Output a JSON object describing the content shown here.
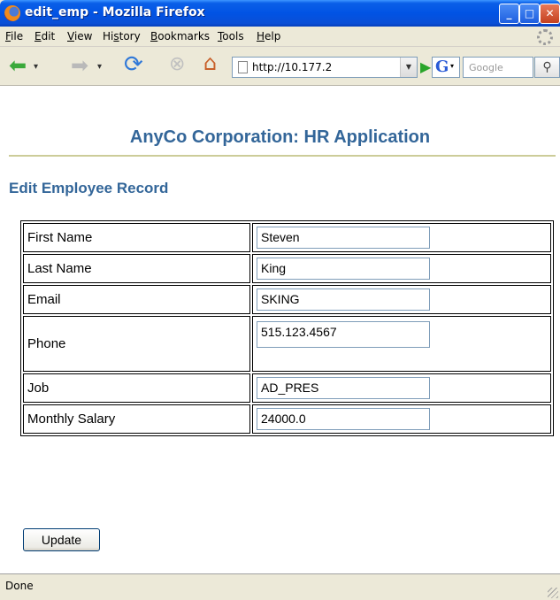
{
  "window": {
    "title": "edit_emp - Mozilla Firefox"
  },
  "menu": [
    {
      "label": "File",
      "accel": "F"
    },
    {
      "label": "Edit",
      "accel": "E"
    },
    {
      "label": "View",
      "accel": "V"
    },
    {
      "label": "History",
      "accel": "s"
    },
    {
      "label": "Bookmarks",
      "accel": "B"
    },
    {
      "label": "Tools",
      "accel": "T"
    },
    {
      "label": "Help",
      "accel": "H"
    }
  ],
  "toolbar": {
    "url": "http://10.177.2",
    "search_engine_letter": "G",
    "search_placeholder": "Google",
    "icons": [
      "back-icon",
      "forward-icon",
      "reload-icon",
      "stop-icon",
      "home-icon",
      "go-icon",
      "search-icon"
    ]
  },
  "page": {
    "app_title": "AnyCo Corporation: HR Application",
    "section_title": "Edit Employee Record",
    "fields": [
      {
        "label": "First Name",
        "value": "Steven"
      },
      {
        "label": "Last Name",
        "value": "King"
      },
      {
        "label": "Email",
        "value": "SKING"
      },
      {
        "label": "Phone",
        "value": "515.123.4567"
      },
      {
        "label": "Job",
        "value": "AD_PRES"
      },
      {
        "label": "Monthly Salary",
        "value": "24000.0"
      }
    ],
    "update_label": "Update"
  },
  "status": {
    "text": "Done"
  },
  "colors": {
    "heading": "#336699",
    "rule": "#cccc99",
    "titlebar": "#0153e4"
  }
}
